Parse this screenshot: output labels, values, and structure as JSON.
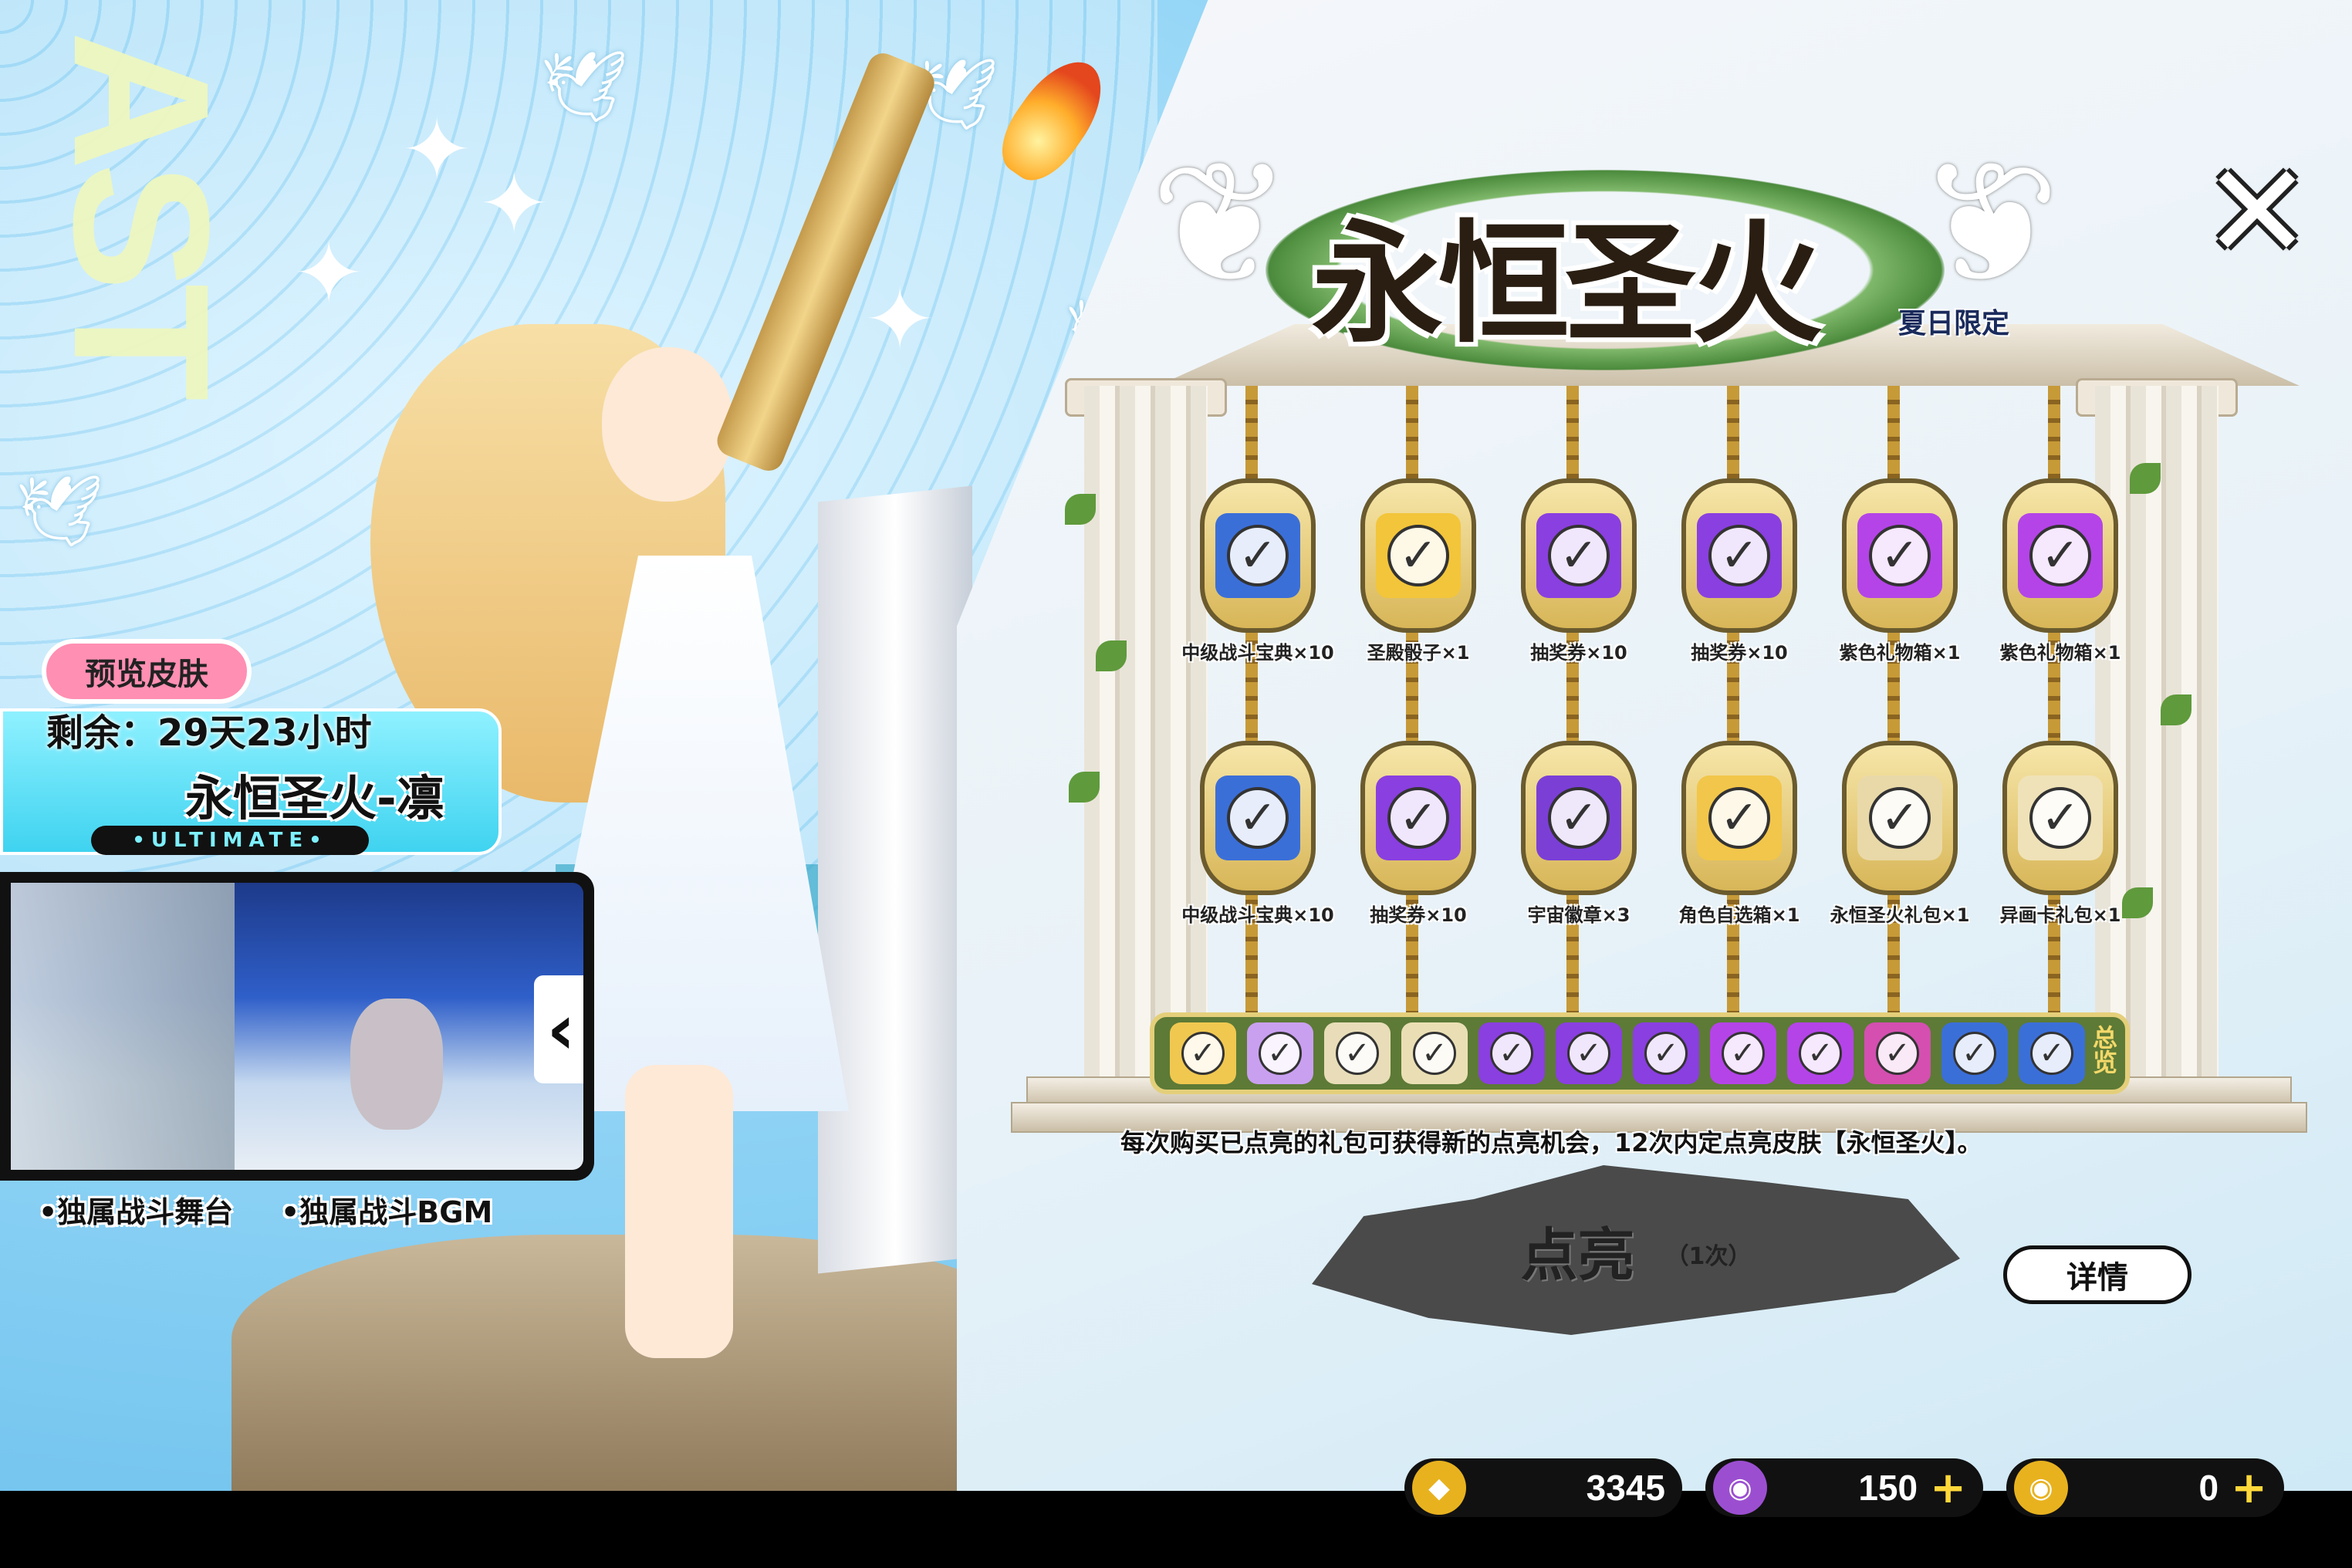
{
  "title": {
    "main": "永恒圣火",
    "tag": "夏日限定"
  },
  "background_text": "AST",
  "close_icon": "✕",
  "preview": {
    "badge": "预览皮肤",
    "remaining": "剩余：29天23小时",
    "skin_name": "永恒圣火-凛",
    "tier": "•ULTIMATE•",
    "features": [
      "•独属战斗舞台",
      "•独属战斗BGM"
    ]
  },
  "rewards_row1": [
    {
      "label": "中级战斗宝典×10",
      "qty": "10",
      "color": "#3b6fd8"
    },
    {
      "label": "圣殿骰子×1",
      "qty": "1",
      "color": "#f3c53a"
    },
    {
      "label": "抽奖券×10",
      "qty": "10",
      "color": "#8a3fe0"
    },
    {
      "label": "抽奖券×10",
      "qty": "10",
      "color": "#8a3fe0"
    },
    {
      "label": "紫色礼物箱×1",
      "qty": "1",
      "color": "#b444e8"
    },
    {
      "label": "紫色礼物箱×1",
      "qty": "1",
      "color": "#b444e8"
    }
  ],
  "rewards_row2": [
    {
      "label": "中级战斗宝典×10",
      "qty": "10",
      "color": "#3b6fd8"
    },
    {
      "label": "抽奖券×10",
      "qty": "10",
      "color": "#8a3fe0"
    },
    {
      "label": "宇宙徽章×3",
      "qty": "3",
      "color": "#7b3fd6"
    },
    {
      "label": "角色自选箱×1",
      "qty": "1",
      "color": "#f2c64a"
    },
    {
      "label": "永恒圣火礼包×1",
      "qty": "1",
      "color": "#e9d9a8"
    },
    {
      "label": "异画卡礼包×1",
      "qty": "1",
      "color": "#efe2b8"
    }
  ],
  "summary": {
    "label": "总览",
    "items": [
      "#f0c850",
      "#c9a0f0",
      "#e8ddb8",
      "#eadfb4",
      "#8a3fe0",
      "#8a3fe0",
      "#8a3fe0",
      "#b444e8",
      "#b444e8",
      "#d44fb0",
      "#3b6fd8",
      "#3b6fd8"
    ]
  },
  "rule_text": "每次购买已点亮的礼包可获得新的点亮机会，12次内定点亮皮肤【永恒圣火】。",
  "light_button": {
    "label": "点亮",
    "count": "（1次）"
  },
  "detail_button": "详情",
  "currencies": [
    {
      "name": "gold-ticket",
      "value": "3345",
      "color": "#e8b21f",
      "plus": ""
    },
    {
      "name": "purple-disc",
      "value": "150",
      "color": "#9b4fd0",
      "plus": "+"
    },
    {
      "name": "gold-disc",
      "value": "0",
      "color": "#e8b21f",
      "plus": "+"
    }
  ],
  "colors": {
    "accent_pink": "#ff8fb3",
    "accent_cyan": "#3fd3f0",
    "summary_green": "#5d7a36",
    "frame_gold": "#d8b658"
  }
}
